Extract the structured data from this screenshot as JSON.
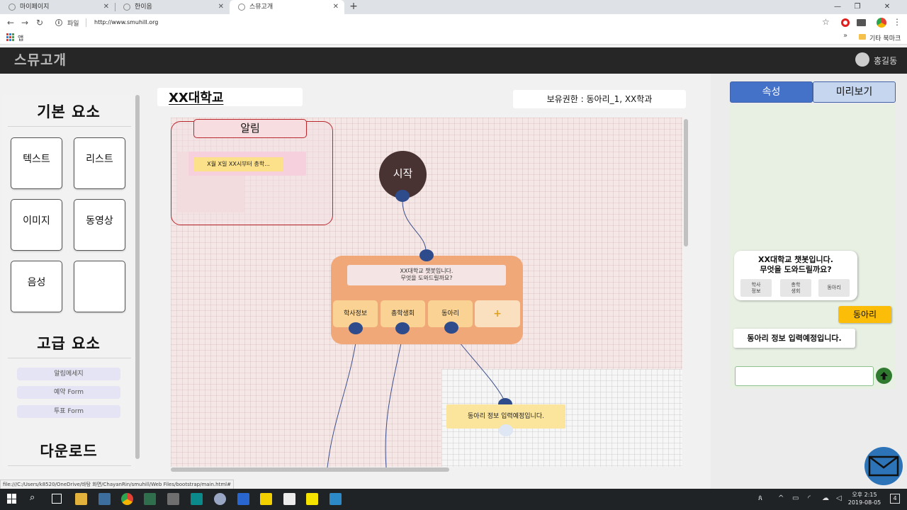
{
  "browser": {
    "tabs": [
      {
        "title": "마이페이지",
        "active": false
      },
      {
        "title": "한이음",
        "active": false
      },
      {
        "title": "스뮤고개",
        "active": true
      }
    ],
    "url_scheme": "파일",
    "url": "http://www.smuhill.org",
    "bookmarks": {
      "apps_label": "앱",
      "more": "»",
      "other": "기타 북마크"
    },
    "status_url": "file:///C:/Users/k8520/OneDrive/바탕 화면/ChayanRin/smuhill/Web Files/bootstrap/main.html#"
  },
  "app": {
    "logo": "스뮤고개",
    "user_name": "홍길동"
  },
  "sidebar": {
    "basic_title": "기본 요소",
    "basic_items": [
      "텍스트",
      "리스트",
      "이미지",
      "동영상",
      "음성",
      ""
    ],
    "advanced_title": "고급 요소",
    "advanced_items": [
      "알림메세지",
      "예약 Form",
      "투표 Form"
    ],
    "download_title": "다운로드"
  },
  "editor": {
    "project_title": "XX대학교",
    "permission": "보유권한 : 동아리_1, XX학과",
    "notice": {
      "title": "알림",
      "text": "X월 X일 XX시부터 총학..."
    },
    "start_node": "시작",
    "chat_node": {
      "message_line1": "XX대학교 챗봇입니다.",
      "message_line2": "무엇을 도와드릴까요?",
      "choices": [
        "학사정보",
        "총학생회",
        "동아리"
      ],
      "add_label": "+"
    },
    "club_reply": "동아리 정보 입력예정입니다."
  },
  "right_panel": {
    "tabs": [
      "속성",
      "미리보기"
    ],
    "active_tab": "속성",
    "preview": {
      "bot_line1": "XX대학교 챗봇입니다.",
      "bot_line2": "무엇을 도와드릴까요?",
      "bot_choices": [
        {
          "line1": "학사",
          "line2": "정보"
        },
        {
          "line1": "총학",
          "line2": "생회"
        },
        {
          "line1": "동아리",
          "line2": ""
        }
      ],
      "user_message": "동아리",
      "bot_reply": "동아리 정보 입력예정입니다.",
      "input_value": ""
    }
  },
  "taskbar": {
    "time": "오후 2:15",
    "date": "2019-08-05",
    "notifications": "4"
  },
  "colors": {
    "header_bg": "#262626",
    "tab_active": "#4472c8",
    "port": "#2e4c8c",
    "chat_node": "#f1a878",
    "user_bubble": "#fbbd08"
  }
}
